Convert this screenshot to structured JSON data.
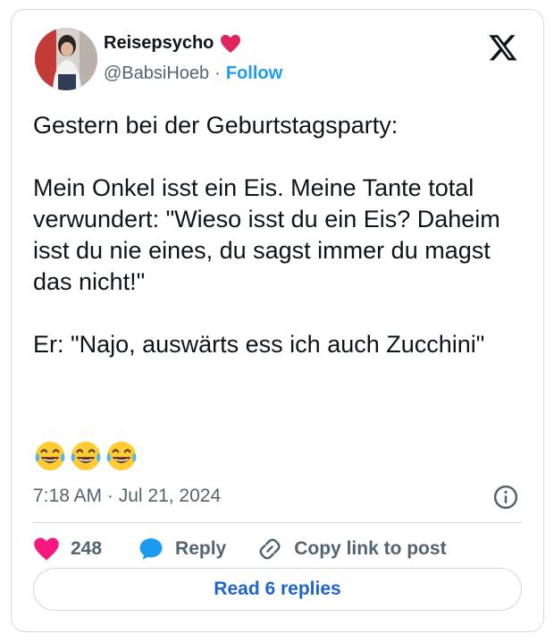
{
  "author": {
    "name": "Reisepsycho",
    "handle": "@BabsiHoeb",
    "separator": "·",
    "follow_label": "Follow"
  },
  "tweet": {
    "paragraphs": [
      "Gestern bei der Geburtstagsparty:",
      "Mein Onkel isst ein Eis. Meine Tante total verwundert: \"Wieso isst du ein Eis? Daheim isst du nie eines, du sagst immer du magst das nicht!\"",
      "Er: \"Najo, auswärts ess ich auch Zucchini\""
    ],
    "emojis": [
      "face-with-tears-of-joy",
      "face-with-tears-of-joy",
      "face-with-tears-of-joy"
    ],
    "timestamp": "7:18 AM · Jul 21, 2024"
  },
  "actions": {
    "like_count": "248",
    "reply_label": "Reply",
    "copy_label": "Copy link to post"
  },
  "footer": {
    "read_replies_label": "Read 6 replies"
  },
  "colors": {
    "accent": "#1d9bf0",
    "heart": "#f91880",
    "badge_heart": "#e0245e",
    "reply": "#1d9bf0",
    "muted": "#536471"
  },
  "icons": [
    "heart-icon",
    "x-logo-icon",
    "info-icon",
    "reply-bubble-icon",
    "link-icon"
  ]
}
